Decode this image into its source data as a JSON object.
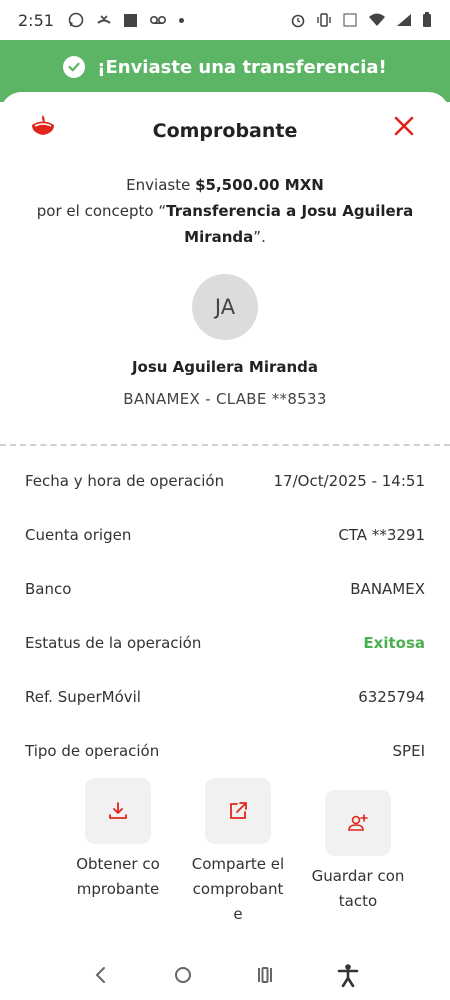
{
  "status_bar": {
    "time": "2:51"
  },
  "banner": {
    "text": "¡Enviaste una transferencia!"
  },
  "header": {
    "title": "Comprobante"
  },
  "summary": {
    "sent_prefix": "Enviaste ",
    "amount": "$5,500.00 MXN",
    "concept_prefix": "por el concepto “",
    "concept": "Transferencia a Josu Aguilera Miranda",
    "concept_suffix": "”."
  },
  "recipient": {
    "initials": "JA",
    "name": "Josu Aguilera Miranda",
    "bank_line": "BANAMEX - CLABE **8533"
  },
  "details": [
    {
      "label": "Fecha y hora de operación",
      "value": "17/Oct/2025 - 14:51"
    },
    {
      "label": "Cuenta origen",
      "value": "CTA **3291"
    },
    {
      "label": "Banco",
      "value": "BANAMEX"
    },
    {
      "label": "Estatus de la operación",
      "value": "Exitosa"
    },
    {
      "label": "Ref. SuperMóvil",
      "value": "6325794"
    },
    {
      "label": "Tipo de operación",
      "value": "SPEI"
    }
  ],
  "actions": [
    {
      "label": "Obtener comprobante",
      "icon": "download-icon"
    },
    {
      "label": "Comparte el comprobante",
      "icon": "share-icon"
    },
    {
      "label": "Guardar contacto",
      "icon": "add-contact-icon"
    }
  ],
  "colors": {
    "success": "#5cb565",
    "brand_red": "#e0261b"
  }
}
